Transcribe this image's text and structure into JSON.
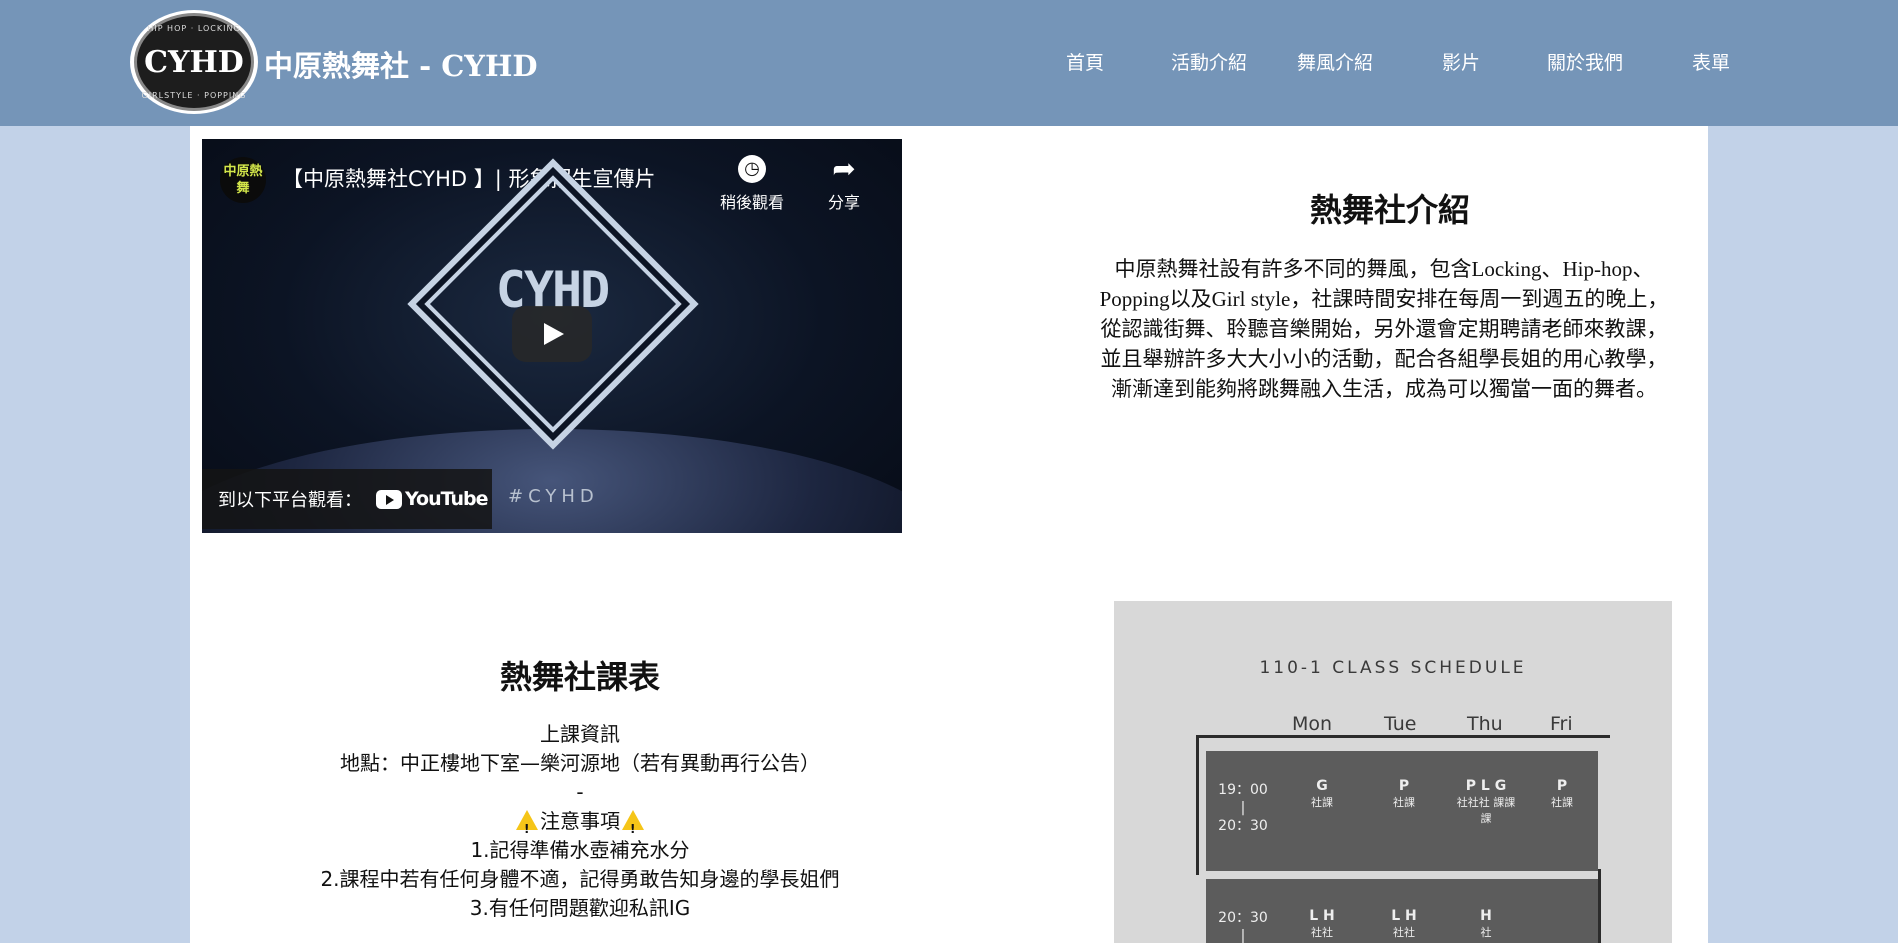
{
  "header": {
    "logo_icon": "cyhd-logo-icon",
    "logo_ring_top": "HIP HOP · LOCKING",
    "logo_ring_bottom": "GIRLSTYLE · POPPING",
    "logo_mark": "CYHD",
    "title": "中原熱舞社 - CYHD",
    "nav": [
      "首頁",
      "活動介紹",
      "舞風介紹",
      "影片",
      "關於我們",
      "表單"
    ]
  },
  "video": {
    "channel_icon_text": "中原熱舞",
    "title": "【中原熱舞社CYHD 】| 形象招生宣傳片",
    "watch_later": "稍後觀看",
    "share": "分享",
    "mark": "CYHD",
    "watch_on": "到以下平台觀看：",
    "youtube": "YouTube",
    "hashtag": "#CYHD"
  },
  "intro": {
    "title": "熱舞社介紹",
    "text": "中原熱舞社設有許多不同的舞風，包含Locking、Hip-hop、Popping以及Girl style，社課時間安排在每周一到週五的晚上，從認識街舞、聆聽音樂開始，另外還會定期聘請老師來教課，並且舉辦許多大大小小的活動，配合各組學長姐的用心教學，漸漸達到能夠將跳舞融入生活，成為可以獨當一面的舞者。"
  },
  "schedule": {
    "title": "熱舞社課表",
    "info_heading": "上課資訊",
    "location": "地點：中正樓地下室—樂河源地（若有異動再行公告）",
    "separator": "-",
    "notice_heading": "注意事項",
    "notes": [
      "1.記得準備水壺補充水分",
      "2.課程中若有任何身體不適，記得勇敢告知身邊的學長姐們",
      "3.有任何問題歡迎私訊IG"
    ]
  },
  "schedule_image": {
    "title": "110-1 CLASS SCHEDULE",
    "days": [
      "Mon",
      "Tue",
      "Thu",
      "Fri"
    ],
    "rows": [
      {
        "time_start": "19：00",
        "time_sep": "|",
        "time_end": "20：30",
        "cells": [
          {
            "code": "G",
            "sub": "社課"
          },
          {
            "code": "P",
            "sub": "社課"
          },
          {
            "code": "P L G",
            "sub": "社社社 課課課"
          },
          {
            "code": "P",
            "sub": "社課"
          }
        ]
      },
      {
        "time_start": "20：30",
        "time_sep": "|",
        "cells": [
          {
            "code": "L H",
            "sub": "社社"
          },
          {
            "code": "L H",
            "sub": "社社"
          },
          {
            "code": "H",
            "sub": "社"
          }
        ]
      }
    ]
  }
}
